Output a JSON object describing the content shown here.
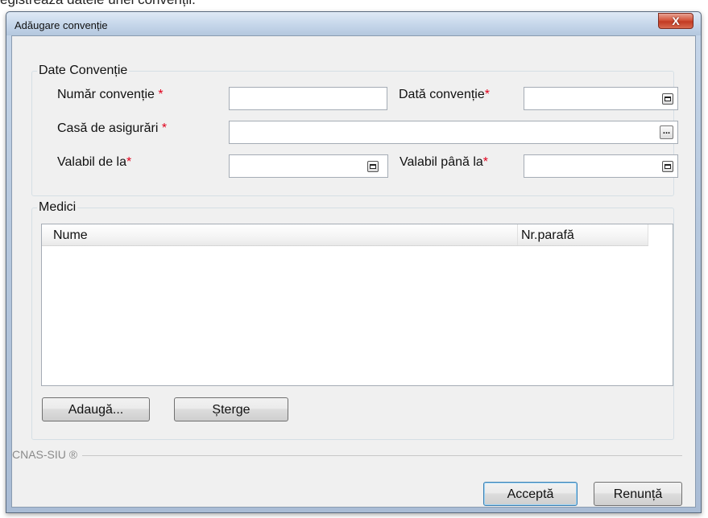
{
  "background_text": "egistrează datele unei convenții.",
  "window": {
    "title": "Adăugare convenție",
    "close_symbol": "X"
  },
  "conventie": {
    "legend": "Date Convenție",
    "numar_label": "Număr convenție",
    "data_label": "Dată convenție",
    "casa_label": "Casă de asigurări",
    "valabil_de_la_label": "Valabil de la",
    "valabil_pana_la_label": "Valabil până la",
    "required_mark": "*",
    "numar_value": "",
    "data_value": "",
    "casa_value": "",
    "valabil_de_la_value": "",
    "valabil_pana_la_value": "",
    "ellipsis": "..."
  },
  "medici": {
    "legend": "Medici",
    "columns": [
      "Nume",
      "Nr.parafă"
    ],
    "rows": [],
    "add_label": "Adaugă...",
    "delete_label": "Șterge"
  },
  "footer": {
    "brand": "CNAS-SIU ®",
    "accept_label": "Acceptă",
    "cancel_label": "Renunță"
  },
  "colors": {
    "required": "#e0001b",
    "close_button": "#c23a22",
    "dialog_face": "#f0f0f0"
  },
  "icons": [
    "calendar-picker-icon",
    "ellipsis-browse-icon",
    "close-icon"
  ]
}
